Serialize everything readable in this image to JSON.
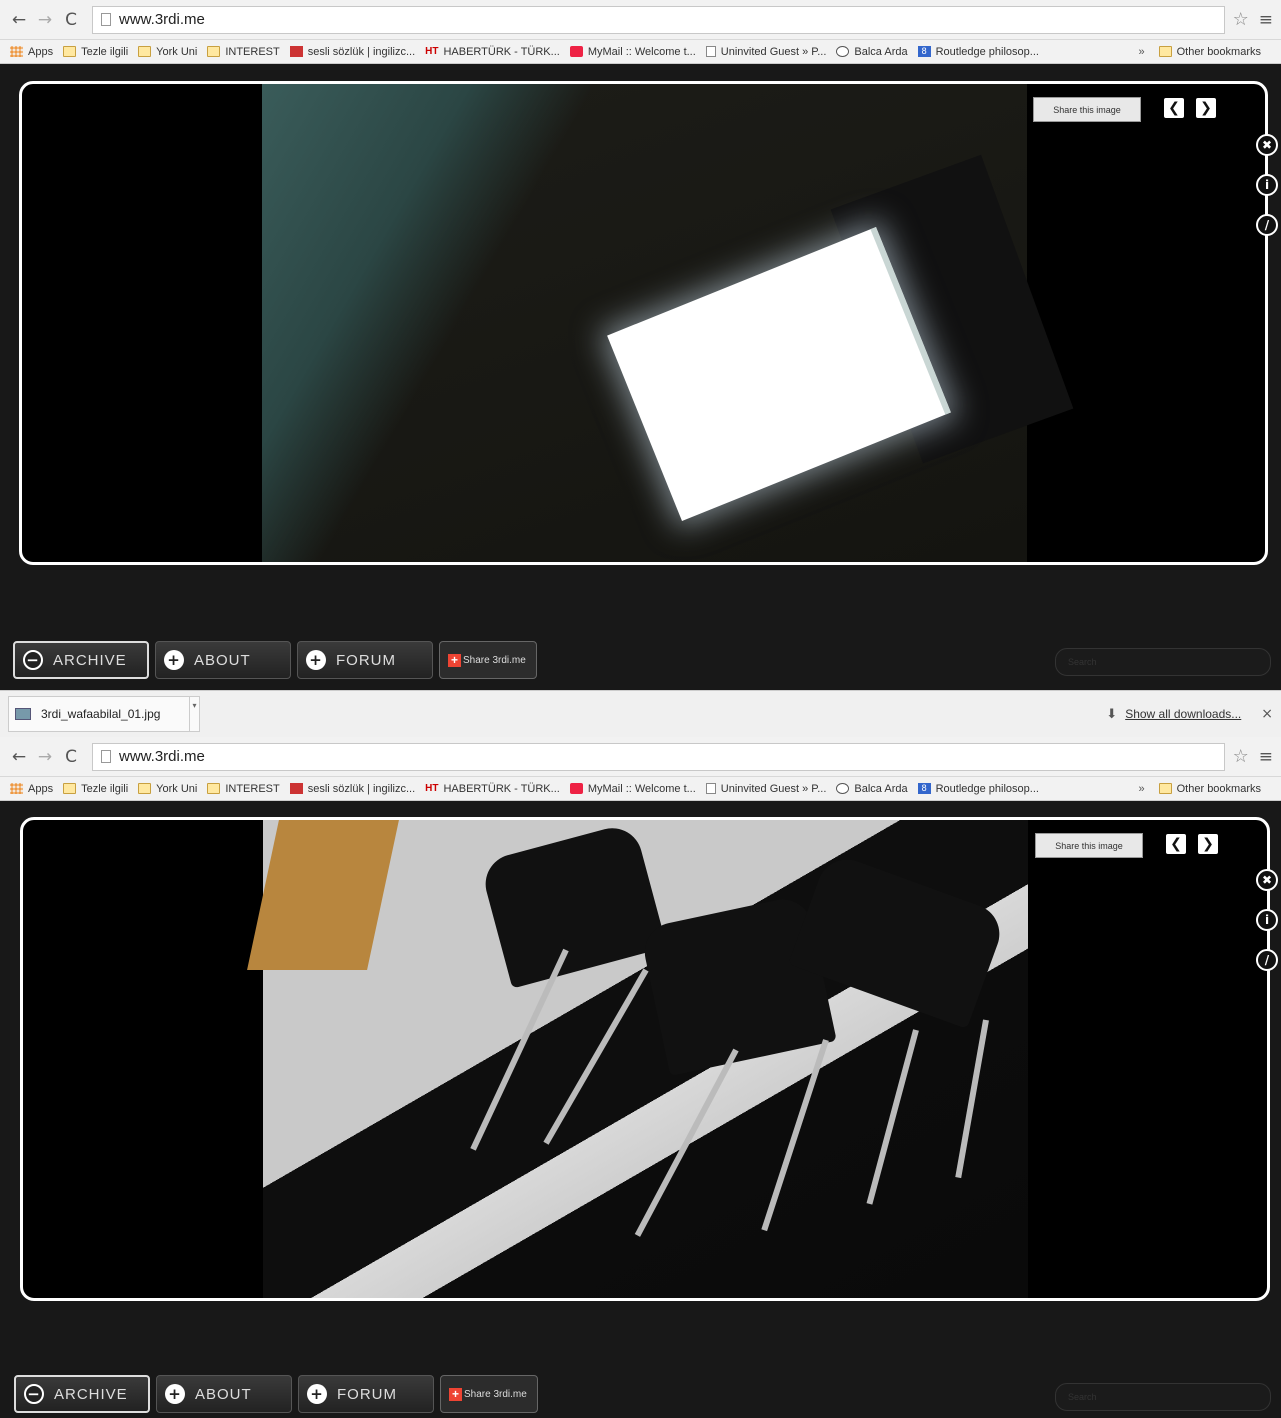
{
  "browser": {
    "url": "www.3rdi.me",
    "bookmarks": [
      {
        "label": "Apps",
        "icon": "apps"
      },
      {
        "label": "Tezle ilgili",
        "icon": "folder"
      },
      {
        "label": "York Uni",
        "icon": "folder"
      },
      {
        "label": "INTEREST",
        "icon": "folder"
      },
      {
        "label": "sesli sözlük | ingilizc...",
        "icon": "red"
      },
      {
        "label": "HABERTÜRK - TÜRK...",
        "icon": "ht"
      },
      {
        "label": "MyMail :: Welcome t...",
        "icon": "mail"
      },
      {
        "label": "Uninvited Guest » P...",
        "icon": "doc"
      },
      {
        "label": "Balca Arda",
        "icon": "wp"
      },
      {
        "label": "Routledge philosop...",
        "icon": "g"
      }
    ],
    "bookmarks_overflow": "»",
    "other_bookmarks": "Other bookmarks",
    "ht_badge": "HT",
    "g_badge": "8"
  },
  "viewer": {
    "share_image": "Share this image",
    "prev": "❮",
    "next": "❯",
    "close_glyph": "✖",
    "info_glyph": "i",
    "edit_glyph": "/"
  },
  "nav": {
    "archive": "ARCHIVE",
    "about": "ABOUT",
    "forum": "FORUM",
    "share_site": "Share 3rdi.me",
    "archive_glyph": "−",
    "plus_glyph": "+"
  },
  "search": {
    "placeholder": "Search"
  },
  "downloads": {
    "file": "3rdi_wafaabilal_01.jpg",
    "show_all": "Show all downloads...",
    "close": "×"
  }
}
